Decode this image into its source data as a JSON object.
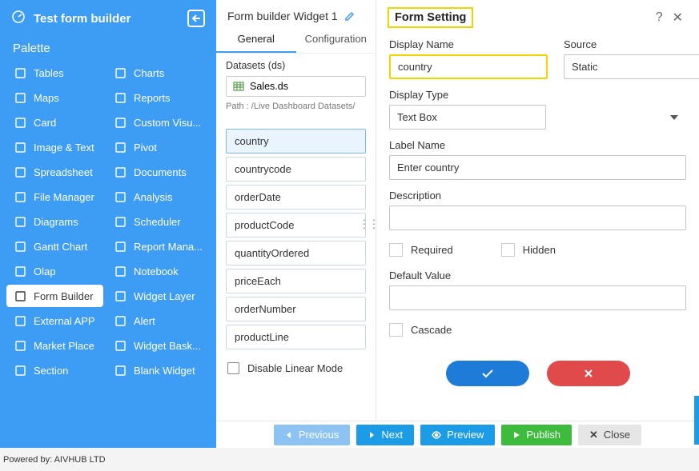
{
  "header": {
    "title": "Test form builder"
  },
  "palette": {
    "title": "Palette",
    "left": [
      {
        "icon": "tables",
        "label": "Tables"
      },
      {
        "icon": "maps",
        "label": "Maps"
      },
      {
        "icon": "card",
        "label": "Card"
      },
      {
        "icon": "image",
        "label": "Image & Text"
      },
      {
        "icon": "sheet",
        "label": "Spreadsheet"
      },
      {
        "icon": "file",
        "label": "File Manager"
      },
      {
        "icon": "diagram",
        "label": "Diagrams"
      },
      {
        "icon": "gantt",
        "label": "Gantt Chart"
      },
      {
        "icon": "olap",
        "label": "Olap"
      },
      {
        "icon": "form",
        "label": "Form Builder"
      },
      {
        "icon": "ext",
        "label": "External APP"
      },
      {
        "icon": "market",
        "label": "Market Place"
      },
      {
        "icon": "section",
        "label": "Section"
      }
    ],
    "right": [
      {
        "icon": "charts",
        "label": "Charts"
      },
      {
        "icon": "reports",
        "label": "Reports"
      },
      {
        "icon": "custom",
        "label": "Custom Visu..."
      },
      {
        "icon": "pivot",
        "label": "Pivot"
      },
      {
        "icon": "docs",
        "label": "Documents"
      },
      {
        "icon": "analysis",
        "label": "Analysis"
      },
      {
        "icon": "sched",
        "label": "Scheduler"
      },
      {
        "icon": "repman",
        "label": "Report Mana..."
      },
      {
        "icon": "notebook",
        "label": "Notebook"
      },
      {
        "icon": "layer",
        "label": "Widget Layer"
      },
      {
        "icon": "alert",
        "label": "Alert"
      },
      {
        "icon": "basket",
        "label": "Widget Bask..."
      },
      {
        "icon": "blank",
        "label": "Blank Widget"
      }
    ]
  },
  "middle": {
    "widget_title": "Form builder Widget 1",
    "tabs": {
      "general": "General",
      "configuration": "Configuration"
    },
    "datasets_label": "Datasets (ds)",
    "dataset_name": "Sales.ds",
    "path_label": "Path : /Live Dashboard Datasets/",
    "fields": [
      "country",
      "countrycode",
      "orderDate",
      "productCode",
      "quantityOrdered",
      "priceEach",
      "orderNumber",
      "productLine"
    ],
    "disable_linear": "Disable Linear Mode"
  },
  "form": {
    "title": "Form Setting",
    "display_name_label": "Display Name",
    "display_name_value": "country",
    "source_label": "Source",
    "source_value": "Static",
    "display_type_label": "Display Type",
    "display_type_value": "Text Box",
    "label_name_label": "Label Name",
    "label_name_value": "Enter country",
    "description_label": "Description",
    "description_value": "",
    "required_label": "Required",
    "hidden_label": "Hidden",
    "default_value_label": "Default Value",
    "default_value_value": "",
    "cascade_label": "Cascade"
  },
  "footer": {
    "previous": "Previous",
    "next": "Next",
    "preview": "Preview",
    "publish": "Publish",
    "close": "Close"
  },
  "poweredby": "Powered by: AIVHUB LTD"
}
